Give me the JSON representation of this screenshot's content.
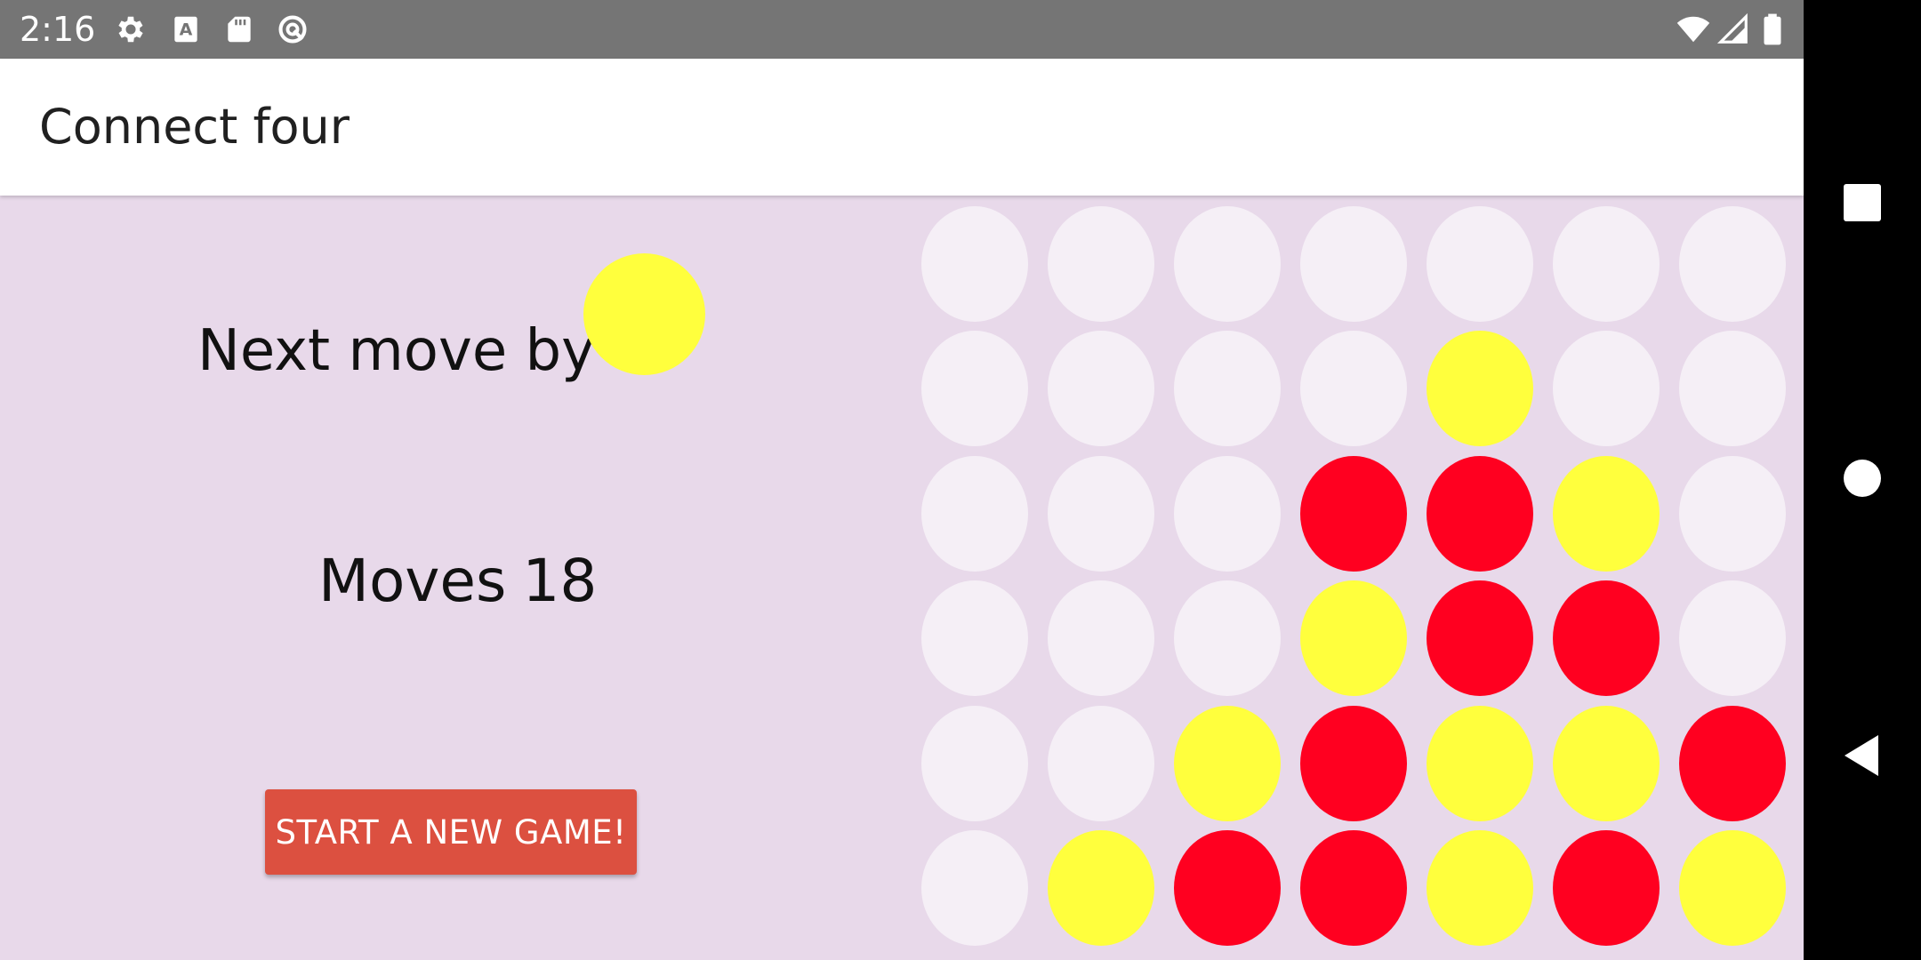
{
  "status_bar": {
    "time": "2:16",
    "left_icons": [
      "gear-icon",
      "font-a-icon",
      "sd-card-icon",
      "no-sync-icon"
    ],
    "right_icons": [
      "wifi-icon",
      "signal-icon",
      "battery-icon"
    ]
  },
  "app_bar": {
    "title": "Connect four"
  },
  "game": {
    "next_move_label": "Next move by",
    "next_player": "yellow",
    "moves_label": "Moves",
    "moves_count": "18",
    "new_game_label": "START A NEW GAME!"
  },
  "colors": {
    "empty": "#f5eff6",
    "yellow": "#ffff3d",
    "red": "#ff0020",
    "background": "#e8d9ea",
    "button": "#dc5040"
  },
  "board": [
    [
      "empty",
      "empty",
      "empty",
      "empty",
      "empty",
      "empty",
      "empty"
    ],
    [
      "empty",
      "empty",
      "empty",
      "empty",
      "yellow",
      "empty",
      "empty"
    ],
    [
      "empty",
      "empty",
      "empty",
      "red",
      "red",
      "yellow",
      "empty"
    ],
    [
      "empty",
      "empty",
      "empty",
      "yellow",
      "red",
      "red",
      "empty"
    ],
    [
      "empty",
      "empty",
      "yellow",
      "red",
      "yellow",
      "yellow",
      "red"
    ],
    [
      "empty",
      "yellow",
      "red",
      "red",
      "yellow",
      "red",
      "yellow"
    ]
  ],
  "nav_bar": {
    "buttons": [
      "recents-icon",
      "home-icon",
      "back-icon"
    ]
  }
}
